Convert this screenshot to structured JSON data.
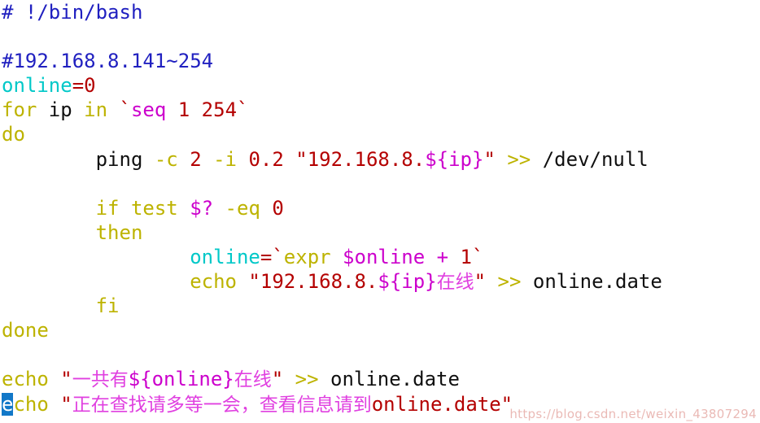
{
  "editor": {
    "language": "bash",
    "background": "#ffffff",
    "font_size_px": 24
  },
  "palette": {
    "comment": "#2020c0",
    "keyword": "#bdb300",
    "variable": "#00c8c8",
    "expansion": "#cc00cc",
    "number": "#b40000",
    "string": "#b40000",
    "plain": "#101010",
    "redirect": "#bdb300",
    "cjk_string": "#e040e0",
    "cursor_selection_bg": "#1278c8",
    "cursor_selection_fg": "#ffffff",
    "watermark": "#c8463c"
  },
  "cursor": {
    "line": 16,
    "column": 1,
    "selected_char": "e"
  },
  "watermark": {
    "text": "https://blog.csdn.net/weixin_43807294"
  },
  "script": {
    "lines": [
      {
        "n": 1,
        "text": "# !/bin/bash"
      },
      {
        "n": 2,
        "text": ""
      },
      {
        "n": 3,
        "text": "#192.168.8.141~254"
      },
      {
        "n": 4,
        "text": "online=0"
      },
      {
        "n": 5,
        "text": "for ip in `seq 1 254`"
      },
      {
        "n": 6,
        "text": "do"
      },
      {
        "n": 7,
        "text": "        ping -c 2 -i 0.2 \"192.168.8.${ip}\" >> /dev/null"
      },
      {
        "n": 8,
        "text": ""
      },
      {
        "n": 9,
        "text": "        if test $? -eq 0"
      },
      {
        "n": 10,
        "text": "        then"
      },
      {
        "n": 11,
        "text": "                online=`expr $online + 1`"
      },
      {
        "n": 12,
        "text": "                echo \"192.168.8.${ip}在线\" >> online.date"
      },
      {
        "n": 13,
        "text": "        fi"
      },
      {
        "n": 14,
        "text": "done"
      },
      {
        "n": 15,
        "text": ""
      },
      {
        "n": 16,
        "text": "echo \"一共有${online}在线\" >> online.date"
      },
      {
        "n": 17,
        "text": "echo \"正在查找请多等一会，查看信息请到online.date\""
      }
    ],
    "tokens": {
      "l1_comment": "# !/bin/bash",
      "l3_comment": "#192.168.8.141~254",
      "l4_var": "online",
      "l4_eq": "=",
      "l4_num": "0",
      "l5_for": "for",
      "l5_ip": " ip ",
      "l5_in": "in",
      "l5_tick_open": " `",
      "l5_seq": "seq",
      "l5_args": " 1 254",
      "l5_tick_close": "`",
      "l6_do": "do",
      "l7_indent": "        ",
      "l7_ping": "ping",
      "l7_flag_c": " -c",
      "l7_two": " 2",
      "l7_flag_i": " -i",
      "l7_point2": " 0.2",
      "l7_quote_open": " \"192.168.8.",
      "l7_expand": "${ip}",
      "l7_quote_close": "\"",
      "l7_redirect": " >>",
      "l7_devnull": " /dev/null",
      "l9_if": "if",
      "l9_test": " test",
      "l9_status": " $?",
      "l9_eq": " -eq",
      "l9_zero": " 0",
      "l10_then": "then",
      "l11_var": "online",
      "l11_assign": "=`",
      "l11_expr": "expr",
      "l11_online": " $online",
      "l11_plus": " + ",
      "l11_one": "1",
      "l11_tick": "`",
      "l12_echo": "echo",
      "l12_str": " \"192.168.8.",
      "l12_expand": "${ip}",
      "l12_cjk": "在线",
      "l12_quote": "\"",
      "l12_redirect": " >>",
      "l12_file": " online.date",
      "l13_fi": "fi",
      "l14_done": "done",
      "l16_echo": "echo",
      "l16_quote_open": " \"",
      "l16_cjk_a": "一共有",
      "l16_expand": "${online}",
      "l16_cjk_b": "在线",
      "l16_quote_close": "\"",
      "l16_redirect": " >>",
      "l16_file": " online.date",
      "l17_echo_first": "e",
      "l17_echo_rest": "cho",
      "l17_quote_open": " \"",
      "l17_cjk": "正在查找请多等一会，查看信息请到",
      "l17_file": "online.date",
      "l17_quote_close": "\""
    }
  }
}
